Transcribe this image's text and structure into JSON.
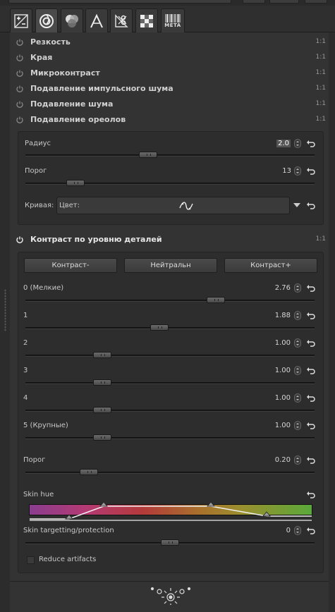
{
  "tabs": [
    {
      "icon": "exposure-icon"
    },
    {
      "icon": "detail-icon",
      "active": true
    },
    {
      "icon": "color-icon"
    },
    {
      "icon": "advanced-icon"
    },
    {
      "icon": "transform-icon"
    },
    {
      "icon": "raw-icon"
    },
    {
      "icon": "metadata-icon",
      "label": "META"
    }
  ],
  "tools": [
    {
      "label": "Резкость",
      "badge": "1:1"
    },
    {
      "label": "Края",
      "badge": "1:1"
    },
    {
      "label": "Микроконтраст",
      "badge": "1:1"
    },
    {
      "label": "Подавление импульсного шума",
      "badge": "1:1"
    },
    {
      "label": "Подавление шума",
      "badge": "1:1"
    },
    {
      "label": "Подавление ореолов",
      "badge": "1:1"
    }
  ],
  "halo": {
    "radius": {
      "label": "Радиус",
      "value": "2.0",
      "level": 0.42
    },
    "threshold": {
      "label": "Порог",
      "value": "13",
      "level": 0.15
    },
    "curve": {
      "label": "Кривая:",
      "value": "Цвет:"
    }
  },
  "contrast_by_detail": {
    "title": "Контраст по уровню деталей",
    "badge": "1:1",
    "buttons": {
      "minus": "Контраст-",
      "neutral": "Нейтральн",
      "plus": "Контраст+"
    },
    "levels": [
      {
        "label": "0 (Мелкие)",
        "value": "2.76",
        "level": 0.67
      },
      {
        "label": "1",
        "value": "1.88",
        "level": 0.46
      },
      {
        "label": "2",
        "value": "1.00",
        "level": 0.25
      },
      {
        "label": "3",
        "value": "1.00",
        "level": 0.25
      },
      {
        "label": "4",
        "value": "1.00",
        "level": 0.25
      },
      {
        "label": "5 (Крупные)",
        "value": "1.00",
        "level": 0.25
      }
    ],
    "threshold": {
      "label": "Порог",
      "value": "0.20",
      "level": 0.2
    },
    "skin_hue": {
      "label": "Skin hue"
    },
    "skin_targetting": {
      "label": "Skin targetting/protection",
      "value": "0",
      "level": 0.5
    },
    "reduce_artifacts": {
      "label": "Reduce artifacts",
      "checked": false
    }
  },
  "footer": {
    "icon": "ornament-icon"
  }
}
